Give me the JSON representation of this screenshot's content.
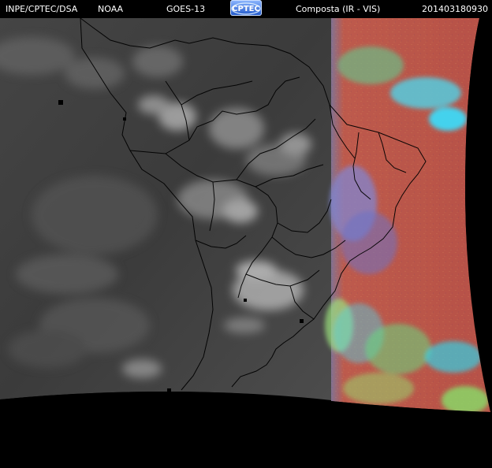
{
  "header": {
    "agency": "INPE/CPTEC/DSA",
    "source": "NOAA",
    "satellite": "GOES-13",
    "logo_text": "CPTEC",
    "product": "Composta (IR - VIS)",
    "timestamp": "201403180930"
  },
  "colors": {
    "background": "#000000",
    "ir_base": "#4a4a4a",
    "vis_land": "#b55c48",
    "vis_cloud_cyan": "#46d1e8",
    "vis_cloud_green": "#8fdc67",
    "vis_cloud_blue": "#6c7bd6",
    "border_lines": "#000000"
  }
}
